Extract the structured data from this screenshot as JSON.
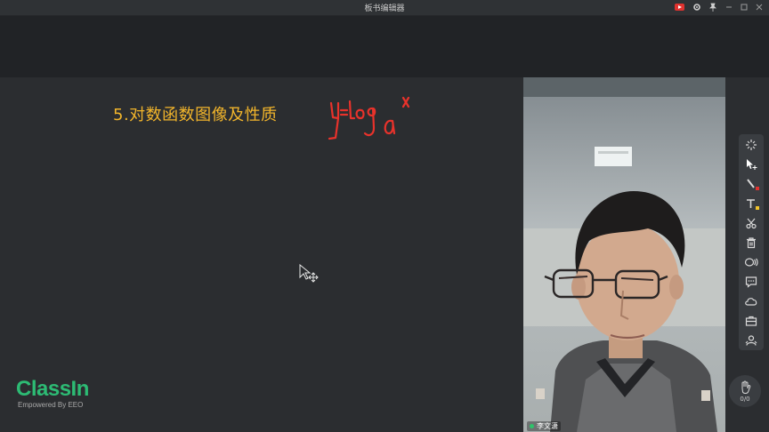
{
  "window": {
    "title": "板书编辑器",
    "controls": [
      "record-icon",
      "gear-icon",
      "pin-icon",
      "minimize-icon",
      "restore-icon",
      "close-icon"
    ],
    "record_color": "#e0322f"
  },
  "board": {
    "slide_title": "5.对数函数图像及性质",
    "title_color": "#f2b52b",
    "handwriting_text": "y=loga x",
    "handwriting_color": "#e8322b"
  },
  "video": {
    "student_name": "李文潇"
  },
  "toolbar": {
    "tools": [
      {
        "name": "laser-pointer-icon"
      },
      {
        "name": "select-move-icon"
      },
      {
        "name": "pen-icon",
        "swatch": "#e0322f"
      },
      {
        "name": "text-icon",
        "swatch": "#f2c42b"
      },
      {
        "name": "scissors-icon"
      },
      {
        "name": "trash-icon"
      },
      {
        "name": "shapes-icon"
      },
      {
        "name": "chat-icon"
      },
      {
        "name": "cloud-icon"
      },
      {
        "name": "toolbox-icon"
      },
      {
        "name": "students-icon"
      }
    ]
  },
  "raise_hand": {
    "count": "0/0"
  },
  "logo": {
    "brand": "ClassIn",
    "tagline": "Empowered By EEO",
    "brand_color": "#2dbb74"
  }
}
